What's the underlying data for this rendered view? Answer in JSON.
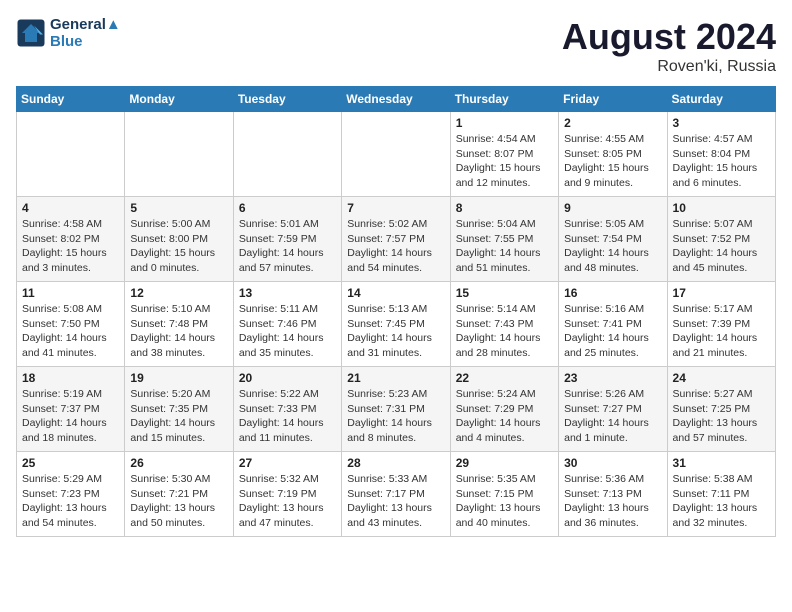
{
  "header": {
    "logo_line1": "General",
    "logo_line2": "Blue",
    "month": "August 2024",
    "location": "Roven'ki, Russia"
  },
  "weekdays": [
    "Sunday",
    "Monday",
    "Tuesday",
    "Wednesday",
    "Thursday",
    "Friday",
    "Saturday"
  ],
  "weeks": [
    [
      {
        "day": "",
        "sunrise": "",
        "sunset": "",
        "daylight": ""
      },
      {
        "day": "",
        "sunrise": "",
        "sunset": "",
        "daylight": ""
      },
      {
        "day": "",
        "sunrise": "",
        "sunset": "",
        "daylight": ""
      },
      {
        "day": "",
        "sunrise": "",
        "sunset": "",
        "daylight": ""
      },
      {
        "day": "1",
        "sunrise": "Sunrise: 4:54 AM",
        "sunset": "Sunset: 8:07 PM",
        "daylight": "Daylight: 15 hours and 12 minutes."
      },
      {
        "day": "2",
        "sunrise": "Sunrise: 4:55 AM",
        "sunset": "Sunset: 8:05 PM",
        "daylight": "Daylight: 15 hours and 9 minutes."
      },
      {
        "day": "3",
        "sunrise": "Sunrise: 4:57 AM",
        "sunset": "Sunset: 8:04 PM",
        "daylight": "Daylight: 15 hours and 6 minutes."
      }
    ],
    [
      {
        "day": "4",
        "sunrise": "Sunrise: 4:58 AM",
        "sunset": "Sunset: 8:02 PM",
        "daylight": "Daylight: 15 hours and 3 minutes."
      },
      {
        "day": "5",
        "sunrise": "Sunrise: 5:00 AM",
        "sunset": "Sunset: 8:00 PM",
        "daylight": "Daylight: 15 hours and 0 minutes."
      },
      {
        "day": "6",
        "sunrise": "Sunrise: 5:01 AM",
        "sunset": "Sunset: 7:59 PM",
        "daylight": "Daylight: 14 hours and 57 minutes."
      },
      {
        "day": "7",
        "sunrise": "Sunrise: 5:02 AM",
        "sunset": "Sunset: 7:57 PM",
        "daylight": "Daylight: 14 hours and 54 minutes."
      },
      {
        "day": "8",
        "sunrise": "Sunrise: 5:04 AM",
        "sunset": "Sunset: 7:55 PM",
        "daylight": "Daylight: 14 hours and 51 minutes."
      },
      {
        "day": "9",
        "sunrise": "Sunrise: 5:05 AM",
        "sunset": "Sunset: 7:54 PM",
        "daylight": "Daylight: 14 hours and 48 minutes."
      },
      {
        "day": "10",
        "sunrise": "Sunrise: 5:07 AM",
        "sunset": "Sunset: 7:52 PM",
        "daylight": "Daylight: 14 hours and 45 minutes."
      }
    ],
    [
      {
        "day": "11",
        "sunrise": "Sunrise: 5:08 AM",
        "sunset": "Sunset: 7:50 PM",
        "daylight": "Daylight: 14 hours and 41 minutes."
      },
      {
        "day": "12",
        "sunrise": "Sunrise: 5:10 AM",
        "sunset": "Sunset: 7:48 PM",
        "daylight": "Daylight: 14 hours and 38 minutes."
      },
      {
        "day": "13",
        "sunrise": "Sunrise: 5:11 AM",
        "sunset": "Sunset: 7:46 PM",
        "daylight": "Daylight: 14 hours and 35 minutes."
      },
      {
        "day": "14",
        "sunrise": "Sunrise: 5:13 AM",
        "sunset": "Sunset: 7:45 PM",
        "daylight": "Daylight: 14 hours and 31 minutes."
      },
      {
        "day": "15",
        "sunrise": "Sunrise: 5:14 AM",
        "sunset": "Sunset: 7:43 PM",
        "daylight": "Daylight: 14 hours and 28 minutes."
      },
      {
        "day": "16",
        "sunrise": "Sunrise: 5:16 AM",
        "sunset": "Sunset: 7:41 PM",
        "daylight": "Daylight: 14 hours and 25 minutes."
      },
      {
        "day": "17",
        "sunrise": "Sunrise: 5:17 AM",
        "sunset": "Sunset: 7:39 PM",
        "daylight": "Daylight: 14 hours and 21 minutes."
      }
    ],
    [
      {
        "day": "18",
        "sunrise": "Sunrise: 5:19 AM",
        "sunset": "Sunset: 7:37 PM",
        "daylight": "Daylight: 14 hours and 18 minutes."
      },
      {
        "day": "19",
        "sunrise": "Sunrise: 5:20 AM",
        "sunset": "Sunset: 7:35 PM",
        "daylight": "Daylight: 14 hours and 15 minutes."
      },
      {
        "day": "20",
        "sunrise": "Sunrise: 5:22 AM",
        "sunset": "Sunset: 7:33 PM",
        "daylight": "Daylight: 14 hours and 11 minutes."
      },
      {
        "day": "21",
        "sunrise": "Sunrise: 5:23 AM",
        "sunset": "Sunset: 7:31 PM",
        "daylight": "Daylight: 14 hours and 8 minutes."
      },
      {
        "day": "22",
        "sunrise": "Sunrise: 5:24 AM",
        "sunset": "Sunset: 7:29 PM",
        "daylight": "Daylight: 14 hours and 4 minutes."
      },
      {
        "day": "23",
        "sunrise": "Sunrise: 5:26 AM",
        "sunset": "Sunset: 7:27 PM",
        "daylight": "Daylight: 14 hours and 1 minute."
      },
      {
        "day": "24",
        "sunrise": "Sunrise: 5:27 AM",
        "sunset": "Sunset: 7:25 PM",
        "daylight": "Daylight: 13 hours and 57 minutes."
      }
    ],
    [
      {
        "day": "25",
        "sunrise": "Sunrise: 5:29 AM",
        "sunset": "Sunset: 7:23 PM",
        "daylight": "Daylight: 13 hours and 54 minutes."
      },
      {
        "day": "26",
        "sunrise": "Sunrise: 5:30 AM",
        "sunset": "Sunset: 7:21 PM",
        "daylight": "Daylight: 13 hours and 50 minutes."
      },
      {
        "day": "27",
        "sunrise": "Sunrise: 5:32 AM",
        "sunset": "Sunset: 7:19 PM",
        "daylight": "Daylight: 13 hours and 47 minutes."
      },
      {
        "day": "28",
        "sunrise": "Sunrise: 5:33 AM",
        "sunset": "Sunset: 7:17 PM",
        "daylight": "Daylight: 13 hours and 43 minutes."
      },
      {
        "day": "29",
        "sunrise": "Sunrise: 5:35 AM",
        "sunset": "Sunset: 7:15 PM",
        "daylight": "Daylight: 13 hours and 40 minutes."
      },
      {
        "day": "30",
        "sunrise": "Sunrise: 5:36 AM",
        "sunset": "Sunset: 7:13 PM",
        "daylight": "Daylight: 13 hours and 36 minutes."
      },
      {
        "day": "31",
        "sunrise": "Sunrise: 5:38 AM",
        "sunset": "Sunset: 7:11 PM",
        "daylight": "Daylight: 13 hours and 32 minutes."
      }
    ]
  ]
}
